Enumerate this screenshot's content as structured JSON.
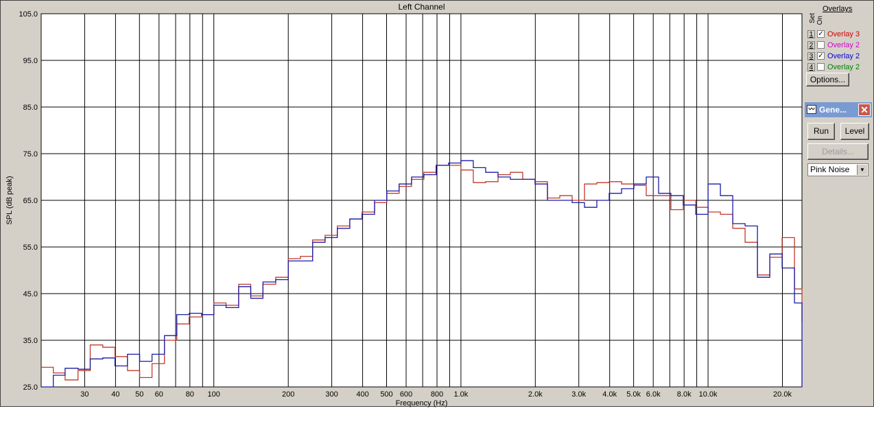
{
  "chart_data": {
    "type": "line",
    "title": "Left Channel",
    "xlabel": "Frequency (Hz)",
    "ylabel": "SPL (dB peak)",
    "xscale": "log",
    "xlim": [
      20,
      24000
    ],
    "ylim": [
      25.0,
      105.0
    ],
    "grid": true,
    "yticks": [
      {
        "v": 25,
        "label": "25.0"
      },
      {
        "v": 35,
        "label": "35.0"
      },
      {
        "v": 45,
        "label": "45.0"
      },
      {
        "v": 55,
        "label": "55.0"
      },
      {
        "v": 65,
        "label": "65.0"
      },
      {
        "v": 75,
        "label": "75.0"
      },
      {
        "v": 85,
        "label": "85.0"
      },
      {
        "v": 95,
        "label": "95.0"
      },
      {
        "v": 105,
        "label": "105.0"
      }
    ],
    "xticks": [
      {
        "v": 30,
        "label": "30"
      },
      {
        "v": 40,
        "label": "40"
      },
      {
        "v": 50,
        "label": "50"
      },
      {
        "v": 60,
        "label": "60"
      },
      {
        "v": 80,
        "label": "80"
      },
      {
        "v": 100,
        "label": "100"
      },
      {
        "v": 200,
        "label": "200"
      },
      {
        "v": 300,
        "label": "300"
      },
      {
        "v": 400,
        "label": "400"
      },
      {
        "v": 500,
        "label": "500"
      },
      {
        "v": 600,
        "label": "600"
      },
      {
        "v": 800,
        "label": "800"
      },
      {
        "v": 1000,
        "label": "1.0k"
      },
      {
        "v": 2000,
        "label": "2.0k"
      },
      {
        "v": 3000,
        "label": "3.0k"
      },
      {
        "v": 4000,
        "label": "4.0k"
      },
      {
        "v": 5000,
        "label": "5.0k"
      },
      {
        "v": 6000,
        "label": "6.0k"
      },
      {
        "v": 8000,
        "label": "8.0k"
      },
      {
        "v": 10000,
        "label": "10.0k"
      },
      {
        "v": 20000,
        "label": "20.0k"
      }
    ],
    "gridlines": [
      30,
      40,
      50,
      60,
      70,
      80,
      90,
      100,
      200,
      300,
      400,
      500,
      600,
      700,
      800,
      900,
      1000,
      2000,
      3000,
      4000,
      5000,
      6000,
      7000,
      8000,
      9000,
      10000,
      20000
    ],
    "x": [
      20,
      22.4,
      25,
      28.2,
      31.6,
      35.5,
      39.8,
      44.7,
      50.1,
      56.2,
      63.1,
      70.8,
      79.4,
      89.1,
      100,
      112,
      126,
      141,
      158,
      178,
      200,
      224,
      251,
      282,
      316,
      355,
      398,
      447,
      501,
      562,
      631,
      708,
      794,
      891,
      1000,
      1122,
      1259,
      1413,
      1585,
      1778,
      1995,
      2239,
      2512,
      2818,
      3162,
      3548,
      3981,
      4467,
      5012,
      5623,
      6310,
      7079,
      7943,
      8913,
      10000,
      11220,
      12589,
      14125,
      15849,
      17783,
      19953,
      22387
    ],
    "series": [
      {
        "name": "Overlay 3",
        "color": "#c0392b",
        "values": [
          29.2,
          28.0,
          26.5,
          28.5,
          34.0,
          33.5,
          31.5,
          28.5,
          27.0,
          30.0,
          35.0,
          38.5,
          40.0,
          40.5,
          43.0,
          42.5,
          47.0,
          44.5,
          47.0,
          48.5,
          52.5,
          53.0,
          56.5,
          57.5,
          59.5,
          61.0,
          62.5,
          64.5,
          66.5,
          68.0,
          69.5,
          71.0,
          72.5,
          72.5,
          71.5,
          68.8,
          69.0,
          70.5,
          71.0,
          69.5,
          69.0,
          65.5,
          66.0,
          65.0,
          68.5,
          68.8,
          69.0,
          68.5,
          68.2,
          66.0,
          66.0,
          63.0,
          65.0,
          63.5,
          62.5,
          62.0,
          59.0,
          56.0,
          49.0,
          52.8,
          57.0,
          46.0,
          39.0
        ]
      },
      {
        "name": "Overlay 2",
        "color": "#1a1aa6",
        "values": [
          25.0,
          27.5,
          29.0,
          28.8,
          31.0,
          31.2,
          29.5,
          32.0,
          30.5,
          32.0,
          36.0,
          40.5,
          40.8,
          40.5,
          42.5,
          42.0,
          46.5,
          44.0,
          47.5,
          48.0,
          52.0,
          52.0,
          56.0,
          57.0,
          59.0,
          61.0,
          62.0,
          65.0,
          67.0,
          68.5,
          70.0,
          70.5,
          72.5,
          73.0,
          73.5,
          72.0,
          71.0,
          70.0,
          69.5,
          69.5,
          68.5,
          65.0,
          65.0,
          64.5,
          63.5,
          65.0,
          66.5,
          67.5,
          68.5,
          70.0,
          66.5,
          66.0,
          64.0,
          62.0,
          68.5,
          66.0,
          60.0,
          59.5,
          48.5,
          53.5,
          50.5,
          43.0,
          40.0,
          25.0
        ]
      }
    ]
  },
  "overlays": {
    "title": "Overlays",
    "col_set": "Set",
    "col_on": "On",
    "rows": [
      {
        "num": "1",
        "checked": "✓",
        "label": "Overlay 3",
        "color": "#d40000"
      },
      {
        "num": "2",
        "checked": "",
        "label": "Overlay 2",
        "color": "#d400d4"
      },
      {
        "num": "3",
        "checked": "✓",
        "label": "Overlay 2",
        "color": "#0000d4"
      },
      {
        "num": "4",
        "checked": "",
        "label": "Overlay 2",
        "color": "#008000"
      }
    ],
    "options_label": "Options..."
  },
  "generator": {
    "title": "Gene...",
    "close": "✕",
    "run_label": "Run",
    "level_label": "Level",
    "details_label": "Details...",
    "signal": "Pink Noise"
  }
}
